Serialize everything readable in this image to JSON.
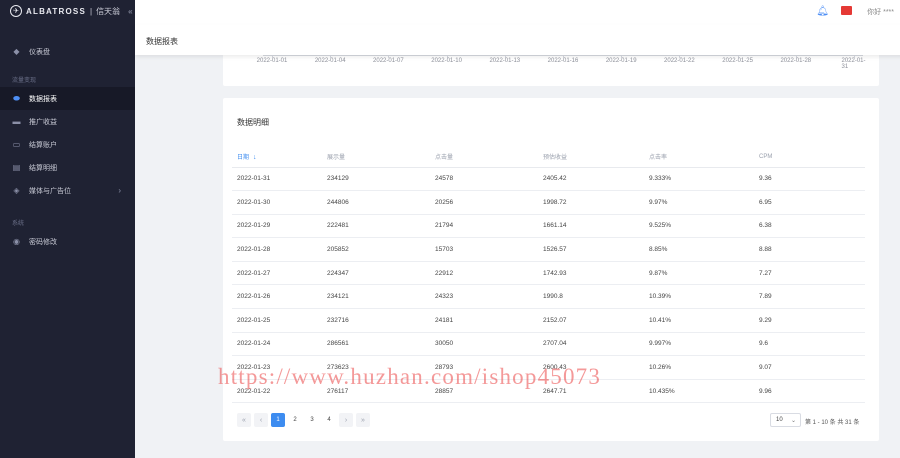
{
  "app": {
    "brand": "ALBATROSS",
    "brand_sub": "信天翁",
    "collapse_icon": "chevron-double-left-icon"
  },
  "header": {
    "user_label": "你好 ****",
    "bell_icon": "bell-icon",
    "flag_icon": "china-flag-icon",
    "flag_color": "#e53935"
  },
  "sidebar": {
    "items": [
      {
        "label": "仪表盘",
        "icon": "dashboard-icon",
        "group": ""
      },
      {
        "label": "数据报表",
        "icon": "toggle-icon",
        "group": "流量变现",
        "active": true
      },
      {
        "label": "推广收益",
        "icon": "wallet-icon",
        "group": ""
      },
      {
        "label": "结算账户",
        "icon": "card-icon",
        "group": ""
      },
      {
        "label": "结算明细",
        "icon": "receipt-icon",
        "group": ""
      },
      {
        "label": "媒体与广告位",
        "icon": "diamond-icon",
        "group": ""
      },
      {
        "label": "密码修改",
        "icon": "lock-icon",
        "group": "系统"
      }
    ],
    "groups": [
      "流量变现",
      "系统"
    ]
  },
  "page": {
    "title": "数据报表"
  },
  "chart_data": {
    "type": "line",
    "x": [
      "2022-01-01",
      "2022-01-04",
      "2022-01-07",
      "2022-01-10",
      "2022-01-13",
      "2022-01-16",
      "2022-01-19",
      "2022-01-22",
      "2022-01-25",
      "2022-01-28",
      "2022-01-31"
    ],
    "title": "",
    "xlabel": "",
    "ylabel": ""
  },
  "table": {
    "title": "数据明细",
    "columns": [
      "日期",
      "展示量",
      "点击量",
      "预估收益",
      "点击率",
      "CPM"
    ],
    "rows": [
      [
        "2022-01-31",
        "234129",
        "24578",
        "2405.42",
        "9.333%",
        "9.36"
      ],
      [
        "2022-01-30",
        "244806",
        "20256",
        "1998.72",
        "9.97%",
        "6.95"
      ],
      [
        "2022-01-29",
        "222481",
        "21794",
        "1661.14",
        "9.525%",
        "6.38"
      ],
      [
        "2022-01-28",
        "205852",
        "15703",
        "1526.57",
        "8.85%",
        "8.88"
      ],
      [
        "2022-01-27",
        "224347",
        "22912",
        "1742.93",
        "9.87%",
        "7.27"
      ],
      [
        "2022-01-26",
        "234121",
        "24323",
        "1990.8",
        "10.39%",
        "7.89"
      ],
      [
        "2022-01-25",
        "232716",
        "24181",
        "2152.07",
        "10.41%",
        "9.29"
      ],
      [
        "2022-01-24",
        "286561",
        "30050",
        "2707.04",
        "9.997%",
        "9.6"
      ],
      [
        "2022-01-23",
        "273623",
        "28793",
        "2600.43",
        "10.26%",
        "9.07"
      ],
      [
        "2022-01-22",
        "276117",
        "28857",
        "2647.71",
        "10.435%",
        "9.96"
      ]
    ],
    "sort_icon": "arrow-down-icon"
  },
  "pagination": {
    "pages": [
      "1",
      "2",
      "3",
      "4"
    ],
    "current": "1",
    "first_icon": "double-chevron-left-icon",
    "prev_icon": "chevron-left-icon",
    "next_icon": "chevron-right-icon",
    "last_icon": "double-chevron-right-icon",
    "page_size": "10",
    "info": "第 1 - 10 条 共 31 条"
  },
  "watermark": "https://www.huzhan.com/ishop45073"
}
